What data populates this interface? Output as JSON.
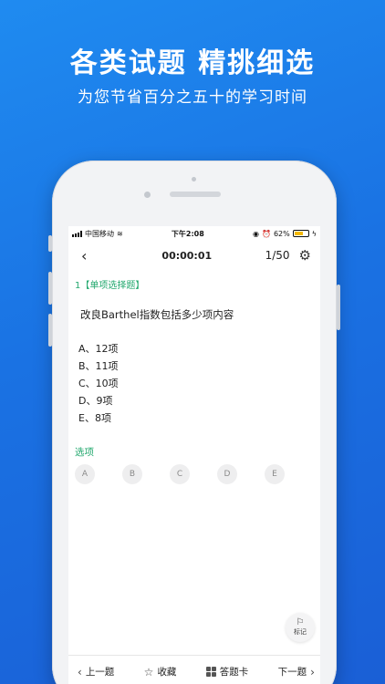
{
  "promo": {
    "headline": "各类试题 精挑细选",
    "subline": "为您节省百分之五十的学习时间"
  },
  "status_bar": {
    "carrier": "中国移动",
    "time": "下午2:08",
    "battery": "62%"
  },
  "nav": {
    "back_icon": "chevron-left-icon",
    "timer": "00:00:01",
    "progress": "1/50",
    "settings_icon": "gear-icon"
  },
  "question": {
    "type_label": "1【单项选择题】",
    "text": "改良Barthel指数包括多少项内容",
    "options": [
      "A、12项",
      "B、11项",
      "C、10项",
      "D、9项",
      "E、8项"
    ]
  },
  "answer": {
    "label": "选项",
    "choices": [
      "A",
      "B",
      "C",
      "D",
      "E"
    ]
  },
  "mark_button": {
    "label": "标记",
    "icon": "flag-icon"
  },
  "bottom_bar": {
    "prev": "上一题",
    "favorite": "收藏",
    "answer_card": "答题卡",
    "next": "下一题"
  },
  "colors": {
    "background": "#1a72e3",
    "accent_green": "#23a86e",
    "battery_yellow": "#f5b800"
  }
}
